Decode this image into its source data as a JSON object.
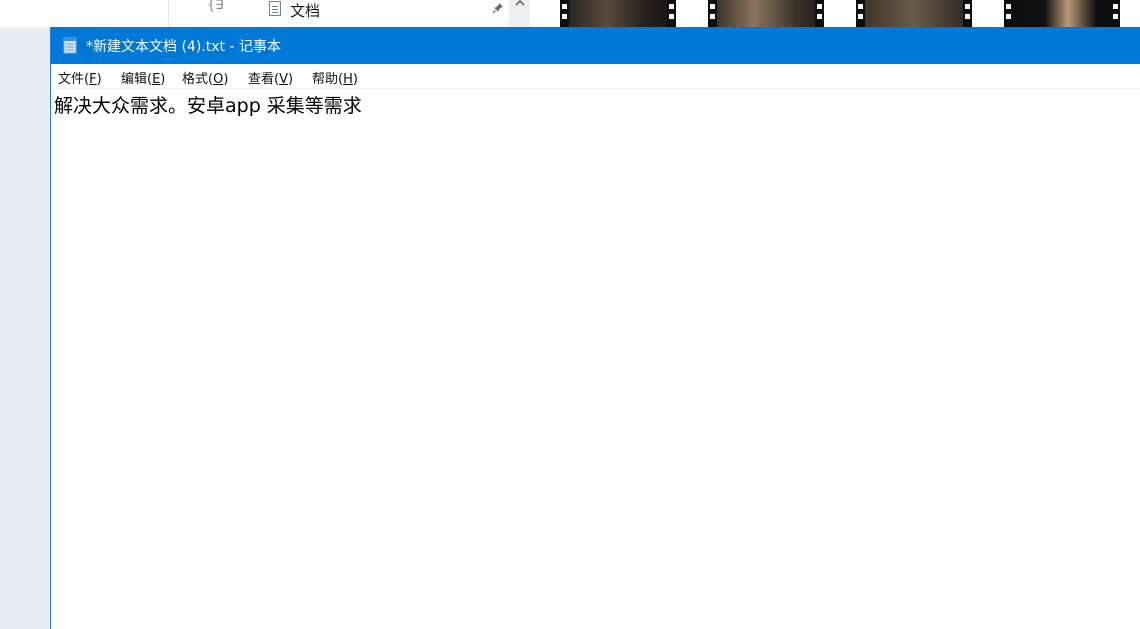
{
  "explorer": {
    "nav_fragment": "{∃",
    "nav_item_label": "文档",
    "pin_glyph": "📌",
    "scroll_up_glyph": "^",
    "thumbnail_count": 4
  },
  "notepad": {
    "title": "*新建文本文档 (4).txt - 记事本",
    "menu": [
      {
        "label": "文件(",
        "accel": "F",
        "close": ")"
      },
      {
        "label": "编辑(",
        "accel": "E",
        "close": ")"
      },
      {
        "label": "格式(",
        "accel": "O",
        "close": ")"
      },
      {
        "label": "查看(",
        "accel": "V",
        "close": ")"
      },
      {
        "label": "帮助(",
        "accel": "H",
        "close": ")"
      }
    ],
    "content": "解决大众需求。安卓app 采集等需求"
  },
  "colors": {
    "titlebar": "#0078d7",
    "window_border": "#2b7bd6",
    "desktop_bg": "#e9edf2"
  }
}
